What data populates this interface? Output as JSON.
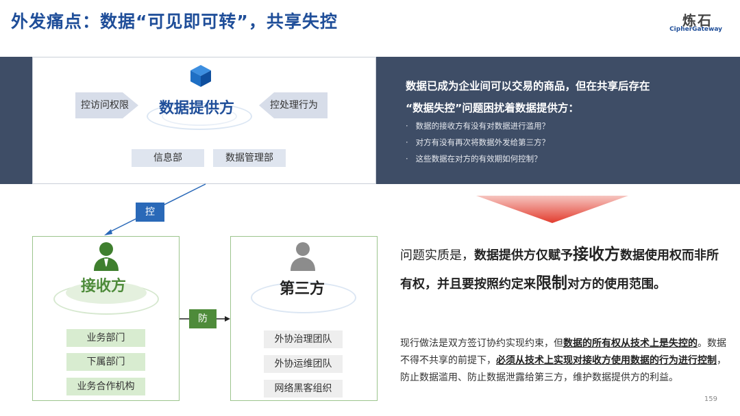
{
  "header": {
    "title": "外发痛点：数据“可见即可转”，共享失控",
    "logo_cn": "炼石",
    "logo_en": "CipherGateway"
  },
  "provider": {
    "title": "数据提供方",
    "left_arrow": "控访问权限",
    "right_arrow": "控处理行为",
    "departments": [
      "信息部",
      "数据管理部"
    ]
  },
  "problem": {
    "line1": "数据已成为企业间可以交易的商品，但在共享后存在",
    "line2": "“数据失控”问题困扰着数据提供方：",
    "bullets": [
      "数据的接收方有没有对数据进行滥用？",
      "对方有没有再次将数据外发给第三方？",
      "这些数据在对方的有效期如何控制？"
    ],
    "bullet_mark": "·"
  },
  "links": {
    "control": "控",
    "prevent": "防"
  },
  "receiver": {
    "title": "接收方",
    "items": [
      "业务部门",
      "下属部门",
      "业务合作机构"
    ]
  },
  "third_party": {
    "title": "第三方",
    "items": [
      "外协治理团队",
      "外协运维团队",
      "网络黑客组织"
    ]
  },
  "essence": {
    "p1": "问题实质是，",
    "p2": "数据提供方仅赋予",
    "p3": "接收方",
    "p4": "数据使用权而非所有权，并且要按照约定来",
    "p5": "限制",
    "p6": "对方的使用范围。"
  },
  "practice": {
    "t1": "现行做法是双方签订协约实现约束，但",
    "t2": "数据的所有权从技术上是失控的",
    "t3": "。数据不得不共享的前提下，",
    "t4": "必须从技术上实现对接收方使用数据的行为进行控制",
    "t5": "，防止数据滥用、防止数据泄露给第三方，维护数据提供方的利益。"
  },
  "page_number": "159",
  "colors": {
    "title_blue": "#1f4e99",
    "band": "#3e4d66",
    "green": "#4e8b3a",
    "red_arrow": "#e23c2e"
  }
}
